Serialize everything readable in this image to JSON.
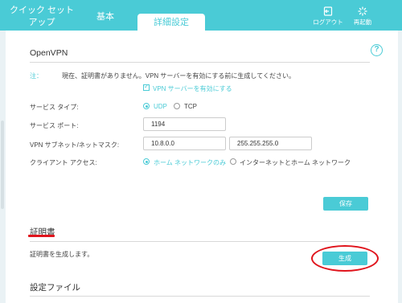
{
  "tabs": {
    "quick_setup_line1": "クイック セット",
    "quick_setup_line2": "アップ",
    "basic": "基本",
    "advanced": "詳細設定"
  },
  "tools": {
    "logout": "ログアウト",
    "reboot": "再起動"
  },
  "openvpn": {
    "title": "OpenVPN",
    "help": "?",
    "note_label": "注：",
    "note_text": "現在、証明書がありません。VPN サーバーを有効にする前に生成してください。",
    "enable_label": "VPN サーバーを有効にする",
    "enable_checked": true,
    "service_type_label": "サービス タイプ:",
    "service_type_options": [
      "UDP",
      "TCP"
    ],
    "service_type_selected": "UDP",
    "service_port_label": "サービス ポート:",
    "service_port_value": "1194",
    "subnet_label": "VPN サブネット/ネットマスク:",
    "subnet_value": "10.8.0.0",
    "netmask_value": "255.255.255.0",
    "client_access_label": "クライアント アクセス:",
    "client_access_options": [
      "ホーム ネットワークのみ",
      "インターネットとホーム ネットワーク"
    ],
    "client_access_selected": "ホーム ネットワークのみ",
    "save_label": "保存"
  },
  "certificate": {
    "title": "証明書",
    "description": "証明書を生成します。",
    "generate_label": "生成"
  },
  "config_file": {
    "title": "設定ファイル"
  },
  "colors": {
    "accent": "#4acbd6",
    "highlight": "#e0141c"
  }
}
